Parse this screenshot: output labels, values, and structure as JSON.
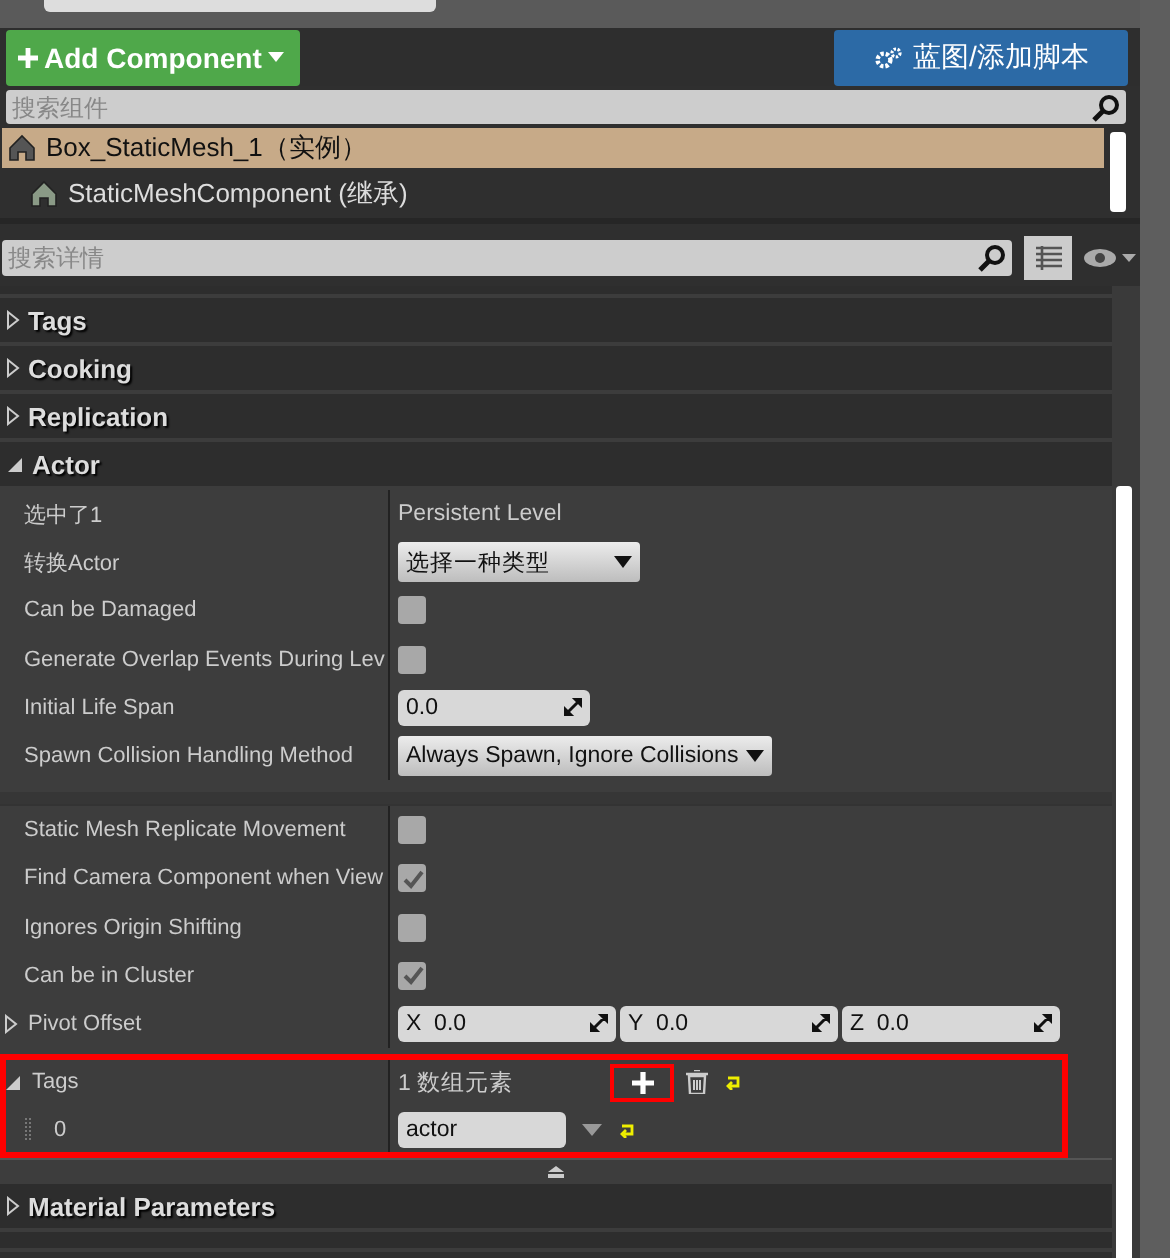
{
  "toolbar": {
    "add_button": "Add Component",
    "blueprint_button": "蓝图/添加脚本"
  },
  "components_search": {
    "placeholder": "搜索组件"
  },
  "components": [
    {
      "label": "Box_StaticMesh_1（实例）",
      "selected": true
    },
    {
      "label": "StaticMeshComponent (继承)",
      "selected": false
    }
  ],
  "details_search": {
    "placeholder": "搜索详情"
  },
  "categories": [
    {
      "label": "Tags",
      "expanded": false
    },
    {
      "label": "Cooking",
      "expanded": false
    },
    {
      "label": "Replication",
      "expanded": false
    },
    {
      "label": "Actor",
      "expanded": true
    }
  ],
  "properties": [
    {
      "kind": "text",
      "name": "选中了1",
      "value": "Persistent Level"
    },
    {
      "kind": "dropdown",
      "name": "转换Actor",
      "value": "选择一种类型"
    },
    {
      "kind": "checkbox",
      "name": "Can be Damaged",
      "checked": false
    },
    {
      "kind": "checkbox",
      "name": "Generate Overlap Events During Lev",
      "checked": false
    },
    {
      "kind": "number",
      "name": "Initial Life Span",
      "value": "0.0"
    },
    {
      "kind": "dropdown",
      "name": "Spawn Collision Handling Method",
      "value": "Always Spawn, Ignore Collisions"
    },
    {
      "kind": "separator"
    },
    {
      "kind": "checkbox",
      "name": "Static Mesh Replicate Movement",
      "checked": false
    },
    {
      "kind": "checkbox",
      "name": "Find Camera Component when View",
      "checked": true
    },
    {
      "kind": "checkbox",
      "name": "Ignores Origin Shifting",
      "checked": false
    },
    {
      "kind": "checkbox",
      "name": "Can be in Cluster",
      "checked": true
    },
    {
      "kind": "vector",
      "name": "Pivot Offset",
      "expanded": false,
      "fields": [
        {
          "axis": "X",
          "value": "0.0"
        },
        {
          "axis": "Y",
          "value": "0.0"
        },
        {
          "axis": "Z",
          "value": "0.0"
        }
      ]
    },
    {
      "kind": "array",
      "name": "Tags",
      "expanded": true,
      "highlighted": true,
      "count": "1 数组元素",
      "items": [
        {
          "index": "0",
          "value": "actor"
        }
      ]
    }
  ],
  "categories_bottom": [
    {
      "label": "Material Parameters",
      "expanded": false
    }
  ]
}
